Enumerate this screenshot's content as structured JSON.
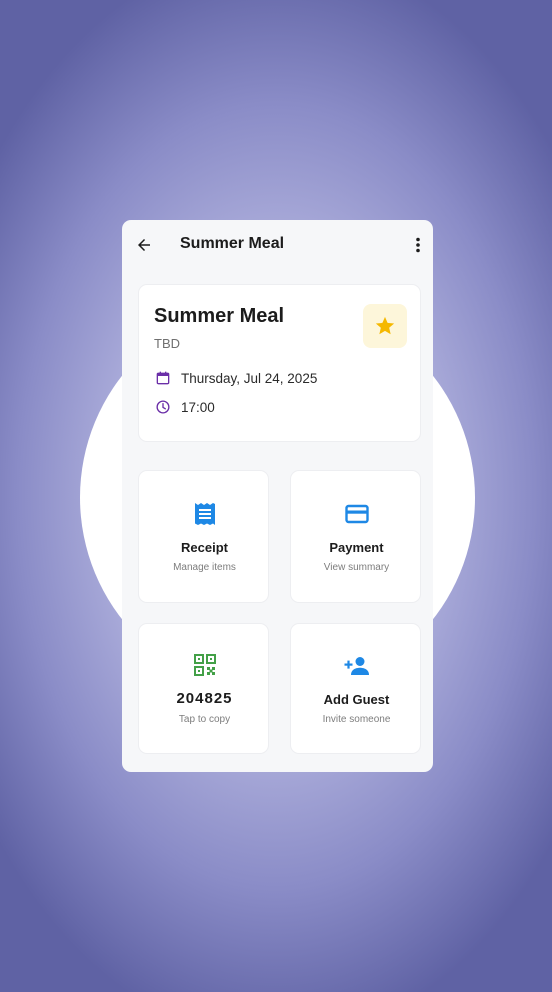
{
  "appbar": {
    "title": "Summer Meal",
    "back_icon": "arrow-left-icon",
    "menu_icon": "more-vertical-icon"
  },
  "event": {
    "title": "Summer Meal",
    "location": "TBD",
    "date": "Thursday, Jul 24, 2025",
    "time": "17:00",
    "favorite_icon": "star-icon",
    "favorited": true
  },
  "tiles": {
    "receipt": {
      "title": "Receipt",
      "subtitle": "Manage items",
      "icon": "receipt-icon"
    },
    "payment": {
      "title": "Payment",
      "subtitle": "View summary",
      "icon": "credit-card-icon"
    },
    "code": {
      "value": "204825",
      "subtitle": "Tap to copy",
      "icon": "qr-code-icon"
    },
    "guest": {
      "title": "Add Guest",
      "subtitle": "Invite someone",
      "icon": "person-add-icon"
    }
  },
  "colors": {
    "accent_purple": "#6b2fa8",
    "accent_blue": "#1e88e5",
    "accent_green": "#43a047",
    "star_yellow": "#f5b800",
    "star_bg": "#fdf6da"
  }
}
